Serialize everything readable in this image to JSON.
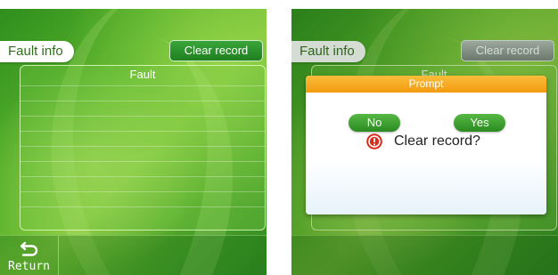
{
  "left_screen": {
    "title": "Fault info",
    "clear_button": "Clear record",
    "list_header": "Fault",
    "return_label": "Return"
  },
  "right_screen": {
    "title": "Fault info",
    "clear_button": "Clear record",
    "list_header": "Fault",
    "dialog": {
      "title": "Prompt",
      "message": "Clear record?",
      "no_label": "No",
      "yes_label": "Yes"
    }
  },
  "icons": {
    "return": "return-arrow-icon",
    "alert": "alert-icon"
  },
  "colors": {
    "accent_green": "#2b8a22",
    "dialog_header_orange": "#f29b10",
    "alert_red": "#d92c1a"
  }
}
